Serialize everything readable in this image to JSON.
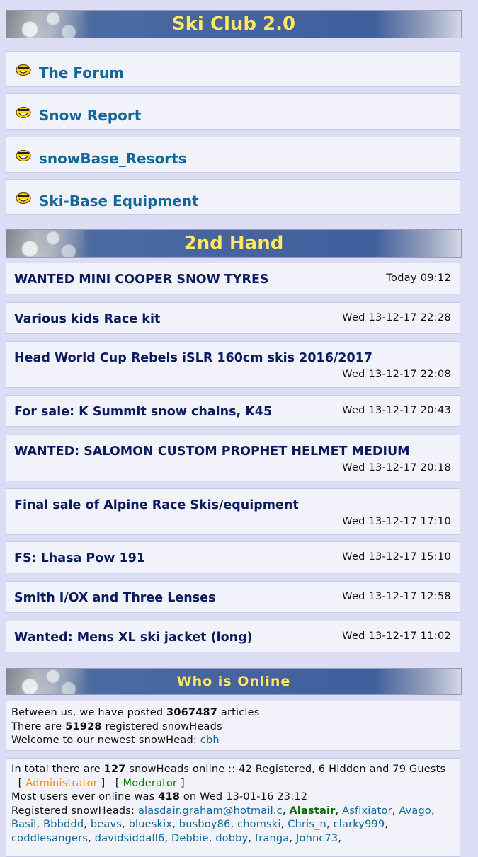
{
  "ski_club": {
    "title": "Ski Club 2.0"
  },
  "forums": [
    {
      "label": "The Forum"
    },
    {
      "label": "Snow Report"
    },
    {
      "label": "snowBase_Resorts"
    },
    {
      "label": "Ski-Base Equipment"
    }
  ],
  "second_hand": {
    "title": "2nd Hand",
    "posts": [
      {
        "title": "WANTED MINI COOPER SNOW TYRES",
        "date": "Today 09:12"
      },
      {
        "title": "Various kids Race kit",
        "date": "Wed 13-12-17 22:28"
      },
      {
        "title": "Head World Cup Rebels iSLR 160cm skis 2016/2017",
        "date": "Wed 13-12-17 22:08"
      },
      {
        "title": "For sale: K Summit snow chains, K45",
        "date": "Wed 13-12-17 20:43"
      },
      {
        "title": "WANTED: SALOMON CUSTOM PROPHET HELMET MEDIUM",
        "date": "Wed 13-12-17 20:18"
      },
      {
        "title": "Final sale of Alpine Race Skis/equipment",
        "date": "Wed 13-12-17 17:10"
      },
      {
        "title": "FS: Lhasa Pow 191",
        "date": "Wed 13-12-17 15:10"
      },
      {
        "title": "Smith I/OX and Three Lenses",
        "date": "Wed 13-12-17 12:58"
      },
      {
        "title": "Wanted: Mens XL ski jacket (long)",
        "date": "Wed 13-12-17 11:02"
      }
    ]
  },
  "online": {
    "title": "Who is Online",
    "stats": {
      "posted_pre": "Between us, we have posted ",
      "articles": "3067487",
      "posted_post": " articles",
      "reg_pre": "There are ",
      "registered": "51928",
      "reg_post": " registered snowHeads",
      "newest_pre": "Welcome to our newest snowHead: ",
      "newest": "cbh"
    },
    "now": {
      "total_pre": "In total there are ",
      "total": "127",
      "total_post": " snowHeads online :: 42 Registered, 6 Hidden and 79 Guests",
      "administrator": "Administrator",
      "moderator": "Moderator",
      "most_pre": "Most users ever online was ",
      "most": "418",
      "most_post": " on Wed 13-01-16 23:12",
      "registered_label": "Registered snowHeads: ",
      "users_line1": [
        "alasdair.graham@hotmail.c"
      ],
      "moderator_user": "Alastair",
      "users_after_mod": [
        "Asfixiator"
      ],
      "users_line2": [
        "Avago",
        "Basil",
        "Bbbddd",
        "beavs",
        "blueskix",
        "busboy86",
        "chomski",
        "Chris_n"
      ],
      "users_line3": [
        "clarky999",
        "coddlesangers",
        "davidsiddall6",
        "Debbie",
        "dobby",
        "franga",
        "Johnc73"
      ]
    }
  },
  "colors": {
    "background": "#dcdcf4",
    "header_text": "#ffe96a",
    "forum_link": "#12689b",
    "post_title": "#0b1b5e",
    "administrator": "#ff8c00",
    "moderator": "#0a7a0a"
  },
  "icons": {
    "forum_icon": "smiley-icon"
  }
}
